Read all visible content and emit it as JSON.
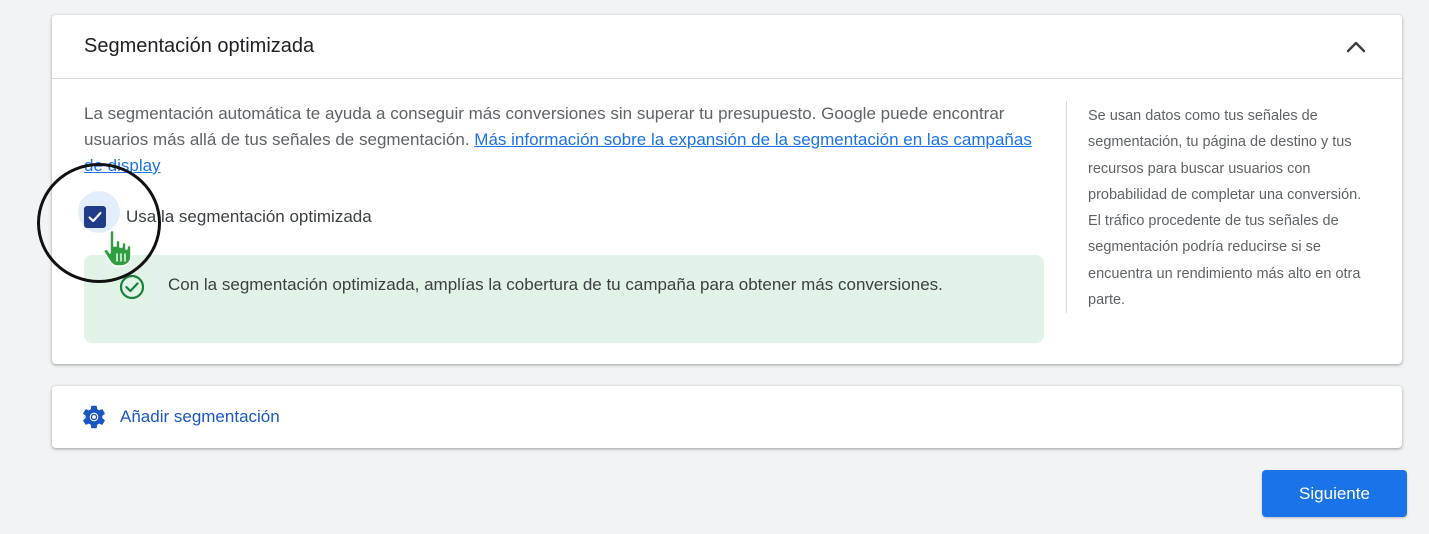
{
  "optimized_section": {
    "title": "Segmentación optimizada",
    "description_text": "La segmentación automática te ayuda a conseguir más conversiones sin superar tu presupuesto. Google puede encontrar usuarios más allá de tus señales de segmentación. ",
    "learn_more_link": "Más información sobre la expansión de la segmentación en las campañas de display",
    "checkbox_label": "Usa la segmentación optimizada",
    "checkbox_checked": true,
    "info_message": "Con la segmentación optimizada, amplías la cobertura de tu campaña para obtener más conversiones.",
    "side_note": "Se usan datos como tus señales de segmentación, tu página de destino y tus recursos para buscar usuarios con probabilidad de completar una conversión. El tráfico procedente de tus señales de segmentación podría reducirse si se encuentra un rendimiento más alto en otra parte."
  },
  "add_targeting": {
    "label": "Añadir segmentación",
    "icon": "gear-icon"
  },
  "footer": {
    "next_label": "Siguiente"
  },
  "colors": {
    "accent": "#1a73e8",
    "checkbox": "#1f3c88",
    "info_bg": "#e1f2e6",
    "success": "#188038"
  }
}
